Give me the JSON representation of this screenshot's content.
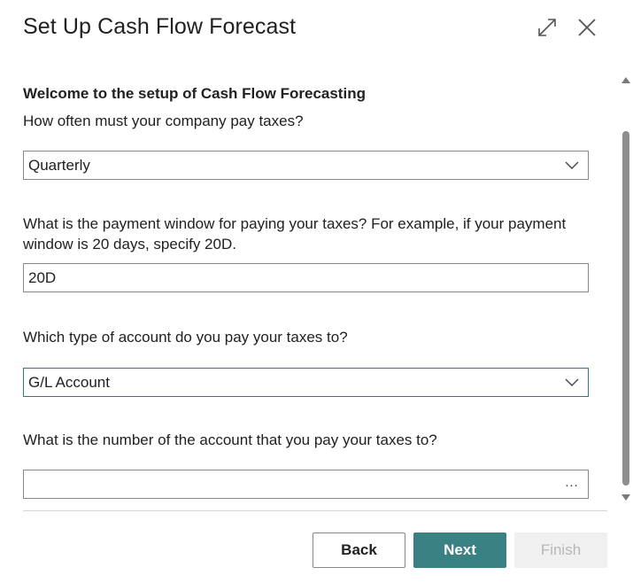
{
  "dialog": {
    "title": "Set Up Cash Flow Forecast",
    "expand_icon": "expand-diagonal-icon",
    "close_icon": "close-icon"
  },
  "form": {
    "welcome": "Welcome to the setup of Cash Flow Forecasting",
    "q_tax_frequency": "How often must your company pay taxes?",
    "tax_frequency_value": "Quarterly",
    "q_payment_window": "What is the payment window for paying your taxes? For example, if your payment window is 20 days, specify 20D.",
    "payment_window_value": "20D",
    "q_account_type": "Which type of account do you pay your taxes to?",
    "account_type_value": "G/L Account",
    "q_account_number": "What is the number of the account that you pay your taxes to?",
    "account_number_value": "",
    "lookup_glyph": "…"
  },
  "footer": {
    "back_label": "Back",
    "next_label": "Next",
    "finish_label": "Finish"
  },
  "colors": {
    "accent": "#3a8184",
    "focus_border": "#2f7a7a",
    "disabled_bg": "#f0f0f0",
    "disabled_text": "#b7b7b7"
  }
}
